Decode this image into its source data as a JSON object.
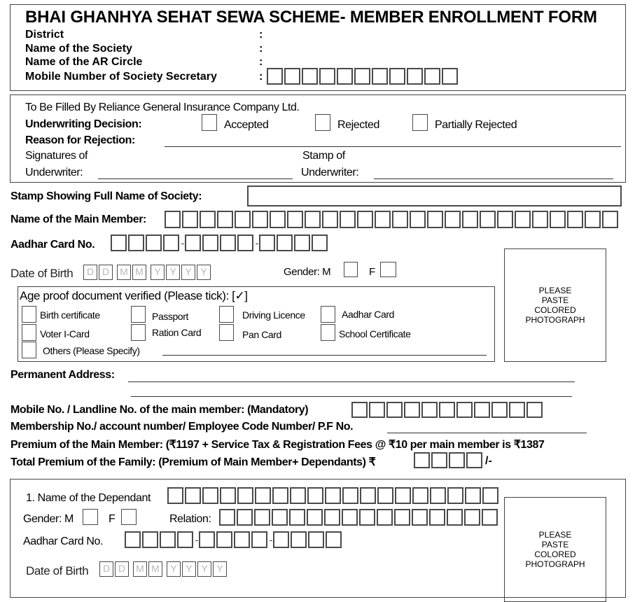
{
  "header": {
    "title": "BHAI GHANHYA SEHAT SEWA SCHEME- MEMBER ENROLLMENT FORM",
    "fields": [
      {
        "label": "District",
        "colon": ":"
      },
      {
        "label": "Name of the Society",
        "colon": ":"
      },
      {
        "label": "Name of the AR Circle",
        "colon": ":"
      },
      {
        "label": "Mobile Number of Society Secretary",
        "colon": ":",
        "boxes": 11
      }
    ]
  },
  "insurer": {
    "heading": "To Be Filled By Reliance General Insurance Company Ltd.",
    "decision_label": "Underwriting Decision:",
    "options": [
      "Accepted",
      "Rejected",
      "Partially Rejected"
    ],
    "reason_label": "Reason for Rejection:",
    "signature_label_1": "Signatures of",
    "signature_label_2": "Underwriter:",
    "stamp_label_1": "Stamp of",
    "stamp_label_2": "Underwriter:"
  },
  "member": {
    "stamp_label": "Stamp Showing Full Name of Society:",
    "name_label": "Name of the Main Member:",
    "name_boxes": 26,
    "aadhar_label": "Aadhar Card No.",
    "aadhar_groups": [
      4,
      4,
      4
    ],
    "aadhar_sep": "-",
    "dob_label": "Date of Birth",
    "dob_placeholders": [
      "D",
      "D",
      "M",
      "M",
      "Y",
      "Y",
      "Y",
      "Y"
    ],
    "gender_label": "Gender: M",
    "gender_f": "F",
    "photo_text": [
      "PLEASE",
      "PASTE",
      "COLORED",
      "PHOTOGRAPH"
    ]
  },
  "age_proof": {
    "heading": "Age proof document verified (Please tick): [✓]",
    "options": [
      "Birth certificate",
      "Passport",
      "Driving Licence",
      "Aadhar Card",
      "Voter I-Card",
      "Ration Card",
      "Pan Card",
      "School Certificate"
    ],
    "others_label": "Others (Please Specify)"
  },
  "contact": {
    "address_label": "Permanent Address:",
    "mobile_label": "Mobile No. / Landline No. of the main member: (Mandatory)",
    "mobile_boxes": 11,
    "membership_label": "Membership No./ account number/ Employee Code Number/ P.F No.",
    "premium_label": "Premium of the Main Member:  (₹1197 + Service Tax & Registration Fees @ ₹10 per main member is ₹1387",
    "total_label": "Total Premium of the Family: (Premium of Main Member+ Dependants) ₹",
    "total_boxes": 4,
    "total_suffix": "/-"
  },
  "dependant": {
    "name_label": "1. Name of the Dependant",
    "name_boxes": 19,
    "gender_label": "Gender: M",
    "gender_f": "F",
    "relation_label": "Relation:",
    "relation_boxes": 16,
    "aadhar_label": "Aadhar Card No.",
    "dob_label": "Date of Birth",
    "photo_text": [
      "PLEASE",
      "PASTE",
      "COLORED",
      "PHOTOGRAPH"
    ]
  }
}
